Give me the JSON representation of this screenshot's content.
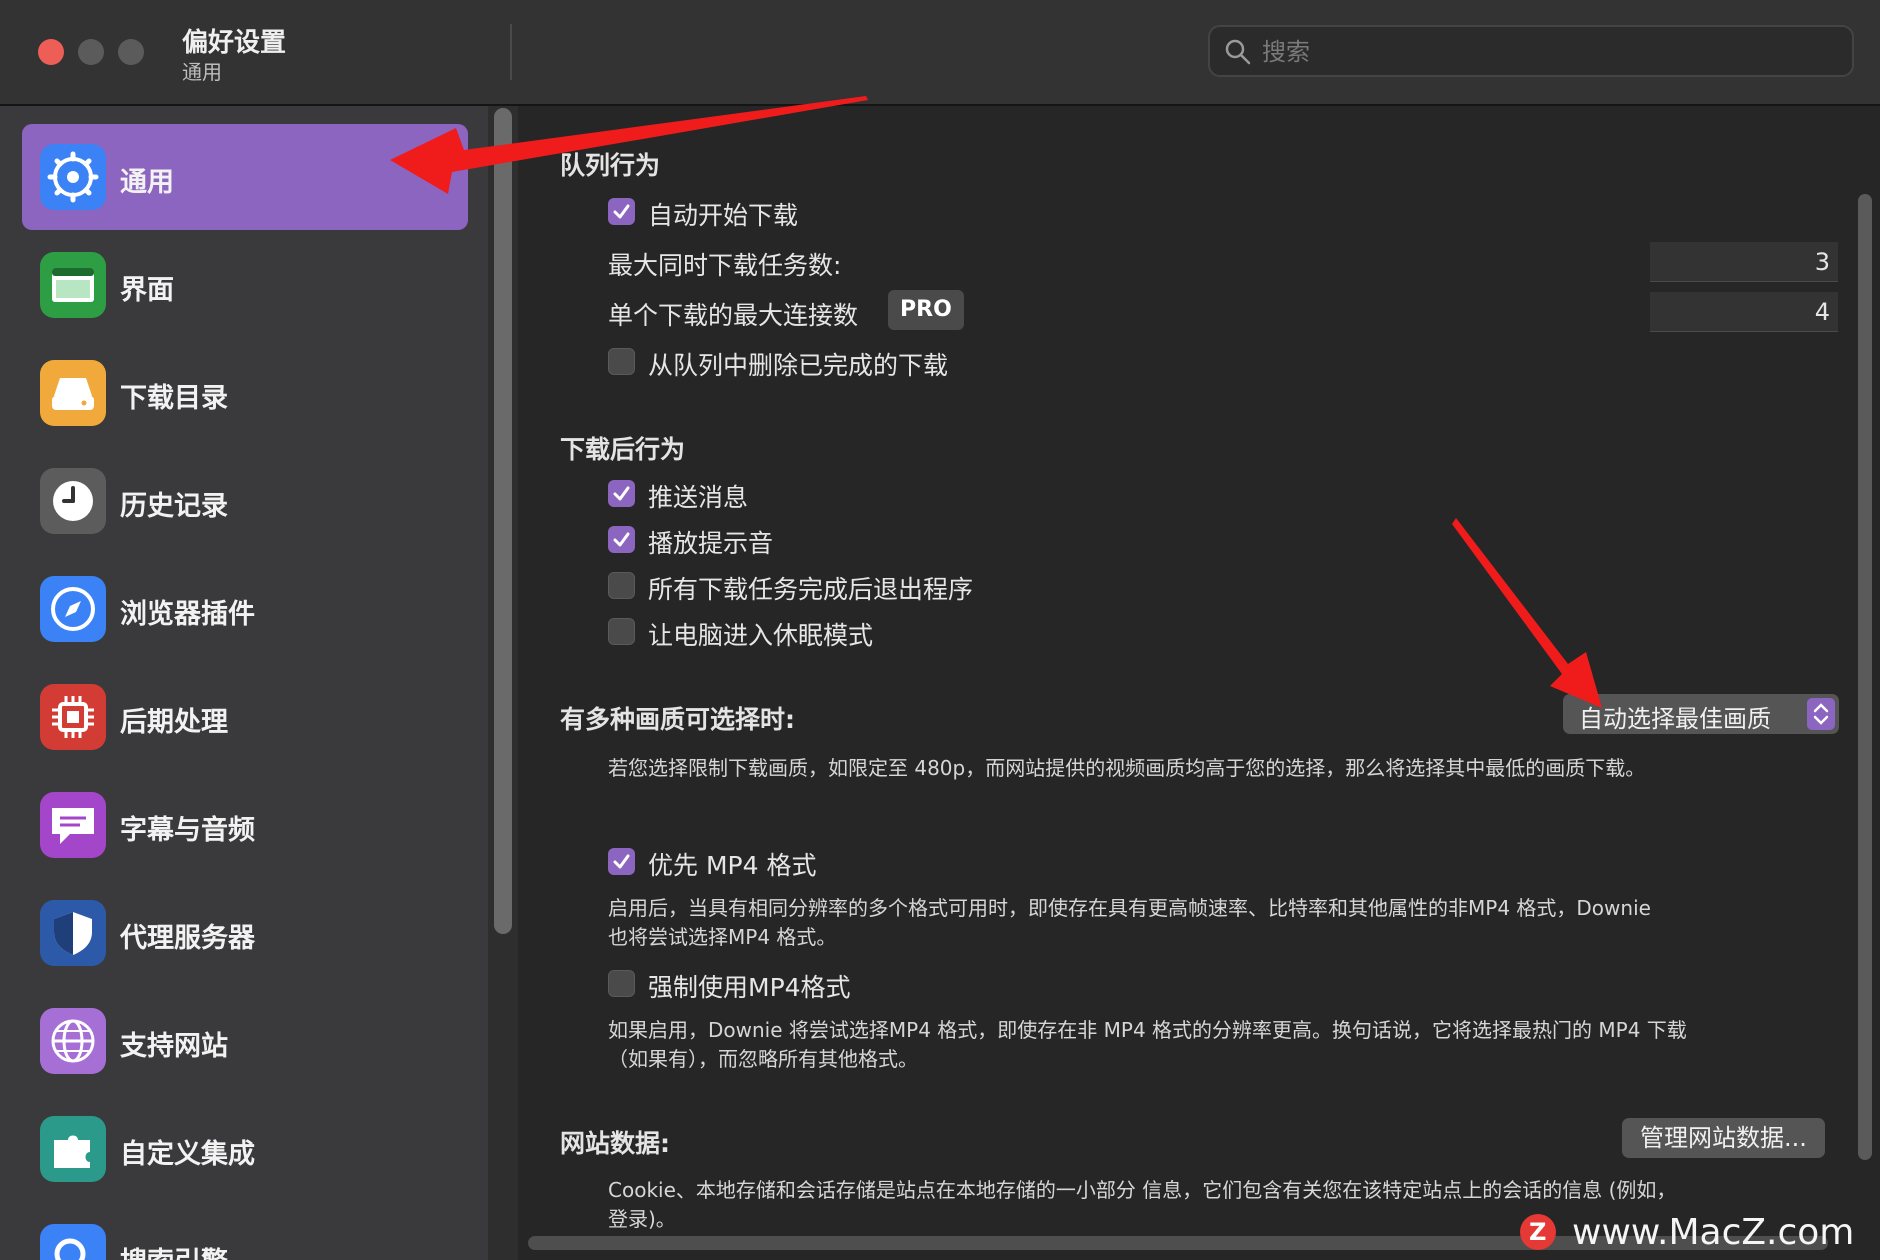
{
  "window": {
    "title": "偏好设置",
    "subtitle": "通用"
  },
  "search": {
    "placeholder": "搜索"
  },
  "sidebar": {
    "items": [
      {
        "label": "通用",
        "icon": "gear-icon",
        "active": true
      },
      {
        "label": "界面",
        "icon": "window-icon"
      },
      {
        "label": "下载目录",
        "icon": "drive-icon"
      },
      {
        "label": "历史记录",
        "icon": "clock-icon"
      },
      {
        "label": "浏览器插件",
        "icon": "compass-icon"
      },
      {
        "label": "后期处理",
        "icon": "chip-icon"
      },
      {
        "label": "字幕与音频",
        "icon": "speech-bubble-icon"
      },
      {
        "label": "代理服务器",
        "icon": "shield-icon"
      },
      {
        "label": "支持网站",
        "icon": "globe-icon"
      },
      {
        "label": "自定义集成",
        "icon": "puzzle-icon"
      },
      {
        "label": "搜索引擎",
        "icon": "magnifier-icon"
      }
    ]
  },
  "queue": {
    "title": "队列行为",
    "auto_start": {
      "label": "自动开始下载",
      "checked": true
    },
    "max_tasks": {
      "label": "最大同时下载任务数:",
      "value": "3"
    },
    "max_connections": {
      "label": "单个下载的最大连接数",
      "badge": "PRO",
      "value": "4"
    },
    "remove_finished": {
      "label": "从队列中删除已完成的下载",
      "checked": false
    }
  },
  "after_download": {
    "title": "下载后行为",
    "push": {
      "label": "推送消息",
      "checked": true
    },
    "sound": {
      "label": "播放提示音",
      "checked": true
    },
    "quit": {
      "label": "所有下载任务完成后退出程序",
      "checked": false
    },
    "sleep": {
      "label": "让电脑进入休眠模式",
      "checked": false
    }
  },
  "quality": {
    "title": "有多种画质可选择时:",
    "selected": "自动选择最佳画质",
    "description": "若您选择限制下载画质，如限定至 480p，而网站提供的视频画质均高于您的选择，那么将选择其中最低的画质下载。"
  },
  "mp4": {
    "prefer": {
      "label": "优先 MP4 格式",
      "checked": true
    },
    "prefer_desc_1": "启用后，当具有相同分辨率的多个格式可用时，即使存在具有更高帧速率、比特率和其他属性的非MP4 格式，Downie",
    "prefer_desc_2": "也将尝试选择MP4 格式。",
    "force": {
      "label": "强制使用MP4格式",
      "checked": false
    },
    "force_desc_1": "如果启用，Downie 将尝试选择MP4 格式，即使存在非 MP4 格式的分辨率更高。换句话说，它将选择最热门的 MP4 下载",
    "force_desc_2": "（如果有），而忽略所有其他格式。"
  },
  "website_data": {
    "title": "网站数据:",
    "button": "管理网站数据...",
    "description_1": "Cookie、本地存储和会话存储是站点在本地存储的一小部分 信息，它们包含有关您在该特定站点上的会话的信息 (例如，",
    "description_2": "登录)。"
  },
  "watermark": {
    "logo_letter": "Z",
    "text": "www.MacZ.com"
  },
  "colors": {
    "accent": "#8c65c0",
    "arrow": "#f01c1c"
  }
}
